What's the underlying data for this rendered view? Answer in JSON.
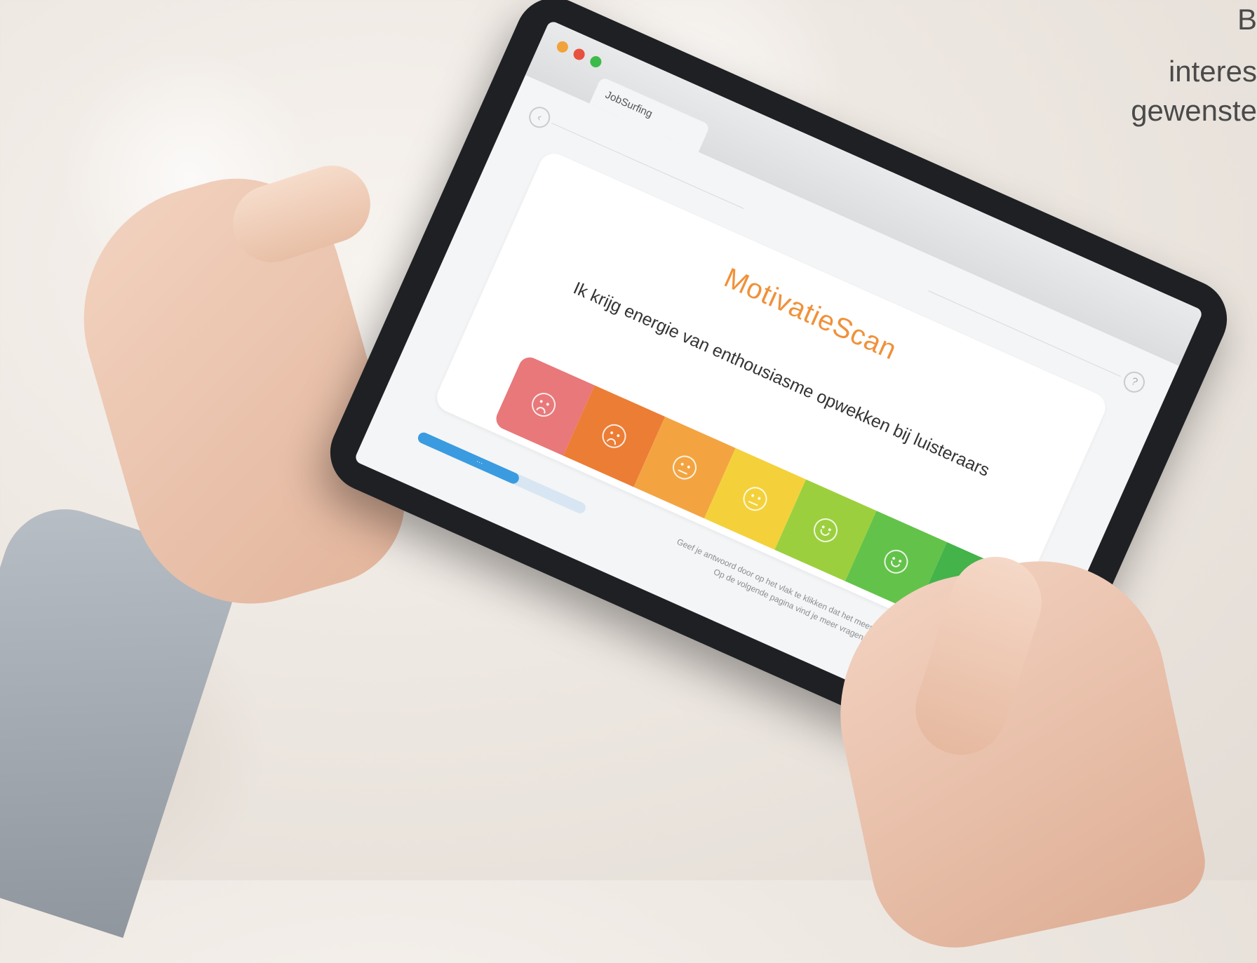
{
  "corner_text": {
    "lines": [
      "B",
      "interes",
      "gewenste"
    ]
  },
  "window": {
    "tab_label": "JobSurfing",
    "back_icon": "chevron-left-icon",
    "help_icon": "question-icon"
  },
  "scan": {
    "title": "MotivatieScan",
    "question": "Ik krijg energie van enthousiasme opwekken bij luisteraars"
  },
  "rating_scale": {
    "levels": 7,
    "colors": [
      "#e8787a",
      "#ec7d35",
      "#f3a441",
      "#f4d13a",
      "#9ccf3e",
      "#63c24a",
      "#43b34a"
    ],
    "faces": [
      "sad-face-icon",
      "sad-face-icon",
      "neutral-face-icon",
      "neutral-face-icon",
      "smile-face-icon",
      "smile-face-icon",
      "laugh-face-icon"
    ]
  },
  "progress": {
    "fraction": 0.6,
    "label": "···"
  },
  "hint": {
    "lines": [
      "Geef je antwoord door op het vlak te klikken dat het meest bij je past",
      "Op de volgende pagina vind je meer vragen"
    ]
  }
}
